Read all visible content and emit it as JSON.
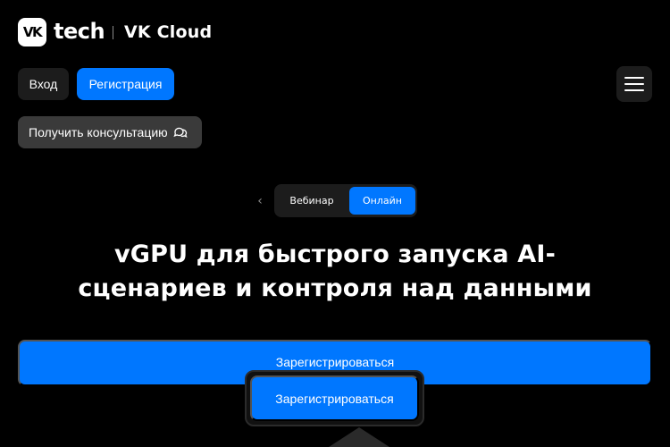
{
  "header": {
    "logo_mark": "VK",
    "logo_word": "tech",
    "product_name": "VK Cloud"
  },
  "auth": {
    "login_label": "Вход",
    "register_label": "Регистрация"
  },
  "consult": {
    "label": "Получить консультацию",
    "icon": "chat-bubbles-icon"
  },
  "menu": {
    "icon": "hamburger-menu-icon"
  },
  "event_toggle": {
    "prev_icon": "chevron-left-icon",
    "options": [
      "Вебинар",
      "Онлайн"
    ],
    "selected": "Онлайн"
  },
  "hero": {
    "title_line1": "vGPU для быстрого запуска AI-",
    "title_line2": "сценариев и контроля над данными"
  },
  "cta": {
    "main_label": "Зарегистрироваться",
    "floating_label": "Зарегистрироваться"
  },
  "colors": {
    "background": "#000000",
    "accent": "#0077ff",
    "button_dark": "#1c1c1c",
    "button_gray": "#3a3a3a"
  }
}
